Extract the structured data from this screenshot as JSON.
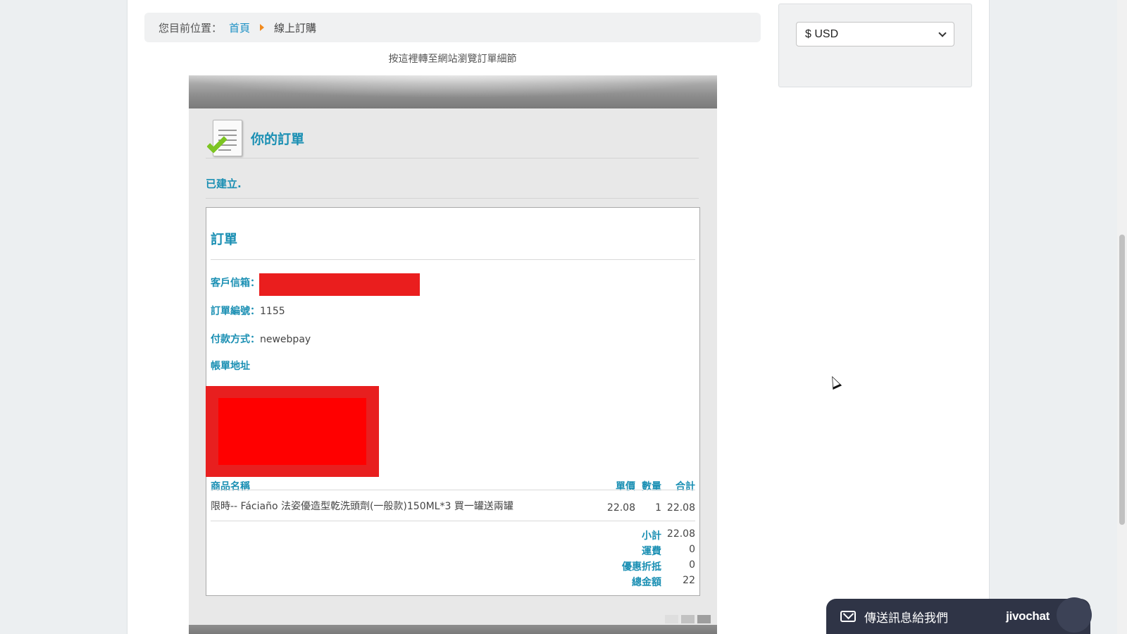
{
  "breadcrumb": {
    "prefix": "您目前位置：",
    "home": "首頁",
    "current": "線上訂購"
  },
  "view_details_link": "按這裡轉至網站瀏覽訂單細節",
  "receipt": {
    "title": "你的訂單",
    "status": "已建立.",
    "order_heading": "訂單",
    "email_label": "客戶信箱：",
    "order_no_label": "訂單編號：",
    "order_no": "1155",
    "payment_label": "付款方式：",
    "payment": "newebpay",
    "billing_label": "帳單地址",
    "columns": {
      "name": "商品名稱",
      "price": "單價",
      "qty": "數量",
      "total": "合計"
    },
    "items": [
      {
        "name": "限時-- Fáciaño 法姿優造型乾洗頭劑(一般款)150ML*3 買一罐送兩罐",
        "price": "22.08",
        "qty": "1",
        "total": "22.08"
      }
    ],
    "summary": [
      {
        "label": "小計",
        "value": "22.08"
      },
      {
        "label": "運費",
        "value": "0"
      },
      {
        "label": "優惠折抵",
        "value": "0"
      },
      {
        "label": "總金額",
        "value": "22"
      }
    ]
  },
  "currency": {
    "selected": "$ USD"
  },
  "chat": {
    "message": "傳送訊息給我們",
    "brand": "jivochat"
  },
  "colors": {
    "accent": "#1a8fb3",
    "link": "#1a8fc4",
    "breadcrumb_arrow": "#f28a1d",
    "redaction": "#ea1e1e"
  }
}
